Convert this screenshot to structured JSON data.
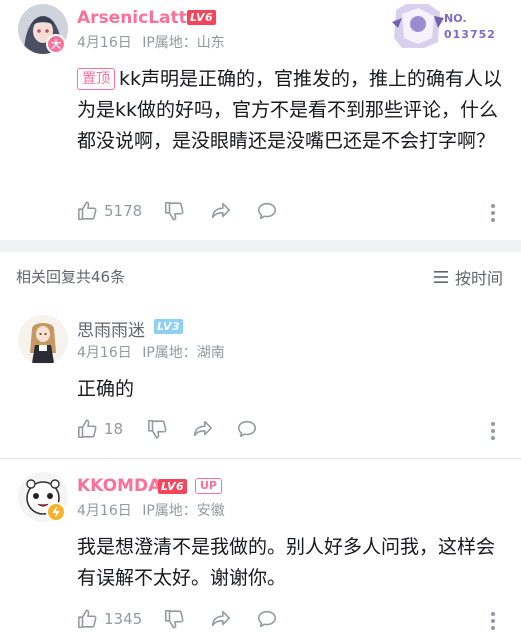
{
  "comments": [
    {
      "username": "ArsenicLatte",
      "level": "LV6",
      "date": "4月16日",
      "ip": "IP属地：山东",
      "pinned_label": "置顶",
      "text": "kk声明是正确的，官推发的，推上的确有人以为是kk做的好吗，官方不是看不到那些评论，什么都没说啊，是没眼睛还是没嘴巴还是不会打字啊？",
      "likes": "5178",
      "fan_badge_label": "NO.",
      "fan_badge_number": "013752"
    },
    {
      "username": "思雨雨迷",
      "level": "LV3",
      "date": "4月16日",
      "ip": "IP属地：湖南",
      "text": "正确的",
      "likes": "18"
    },
    {
      "username": "KKOMDA",
      "level": "LV6",
      "up_label": "UP",
      "date": "4月16日",
      "ip": "IP属地：安徽",
      "text": "我是想澄清不是我做的。别人好多人问我，这样会有误解不太好。谢谢你。",
      "likes": "1345"
    }
  ],
  "replies_header": {
    "count_label": "相关回复共46条",
    "sort_label": "按时间"
  },
  "colors": {
    "accent_pink": "#fb7299",
    "level6_red": "#f6455b",
    "level3_blue": "#8bd1f7",
    "meta_gray": "#9499a0"
  }
}
